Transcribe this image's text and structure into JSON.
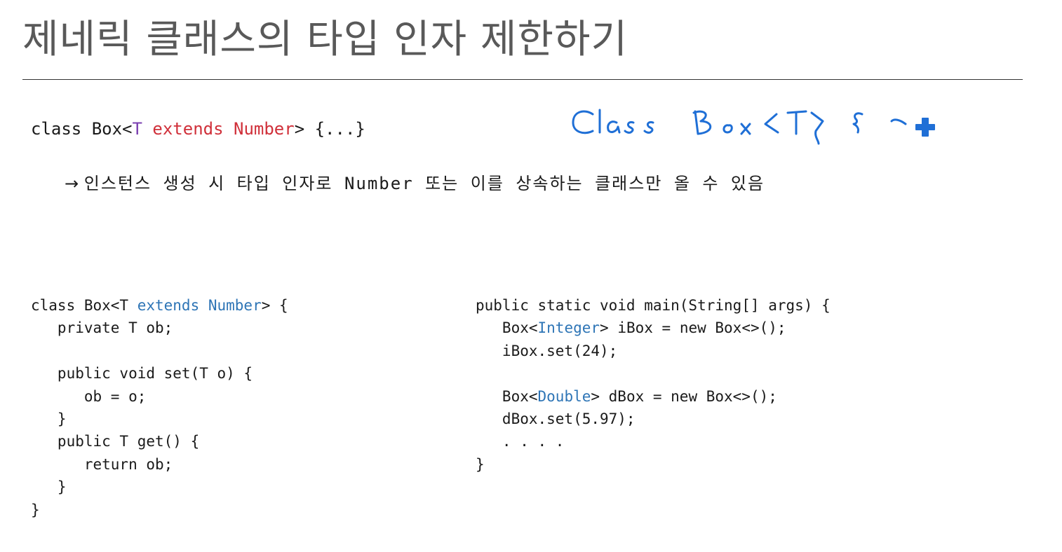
{
  "title": "제네릭 클래스의 타입 인자 제한하기",
  "declaration": {
    "prefix": "class Box<",
    "type_param": "T",
    "space": " ",
    "bound": "extends Number",
    "suffix": "> {...}"
  },
  "note": {
    "arrow": "→",
    "text": "인스턴스 생성 시 타입 인자로 Number 또는 이를 상속하는 클래스만 올 수 있음"
  },
  "code_left": [
    {
      "pre": "class Box<T ",
      "hl": "extends Number",
      "post": "> {"
    },
    {
      "pre": "   private T ob;",
      "hl": "",
      "post": ""
    },
    {
      "pre": "",
      "hl": "",
      "post": ""
    },
    {
      "pre": "   public void set(T o) {",
      "hl": "",
      "post": ""
    },
    {
      "pre": "      ob = o;",
      "hl": "",
      "post": ""
    },
    {
      "pre": "   }",
      "hl": "",
      "post": ""
    },
    {
      "pre": "   public T get() {",
      "hl": "",
      "post": ""
    },
    {
      "pre": "      return ob;",
      "hl": "",
      "post": ""
    },
    {
      "pre": "   }",
      "hl": "",
      "post": ""
    },
    {
      "pre": "}",
      "hl": "",
      "post": ""
    }
  ],
  "code_right": [
    {
      "pre": "public static void main(String[] args) {",
      "hl": "",
      "post": ""
    },
    {
      "pre": "   Box<",
      "hl": "Integer",
      "post": "> iBox = new Box<>();"
    },
    {
      "pre": "   iBox.set(24);",
      "hl": "",
      "post": ""
    },
    {
      "pre": "",
      "hl": "",
      "post": ""
    },
    {
      "pre": "   Box<",
      "hl": "Double",
      "post": "> dBox = new Box<>();"
    },
    {
      "pre": "   dBox.set(5.97);",
      "hl": "",
      "post": ""
    },
    {
      "pre": "   . . . .",
      "hl": "",
      "post": ""
    },
    {
      "pre": "}",
      "hl": "",
      "post": ""
    }
  ],
  "handwriting": {
    "text": "Class Box<T> { -",
    "ink_color": "#1f6fd6",
    "cursor_icon": "plus-cursor-icon"
  },
  "colors": {
    "title": "#595959",
    "bound_red": "#d0303a",
    "type_param_purple": "#7a3fb0",
    "code_blue": "#2e75b6"
  }
}
